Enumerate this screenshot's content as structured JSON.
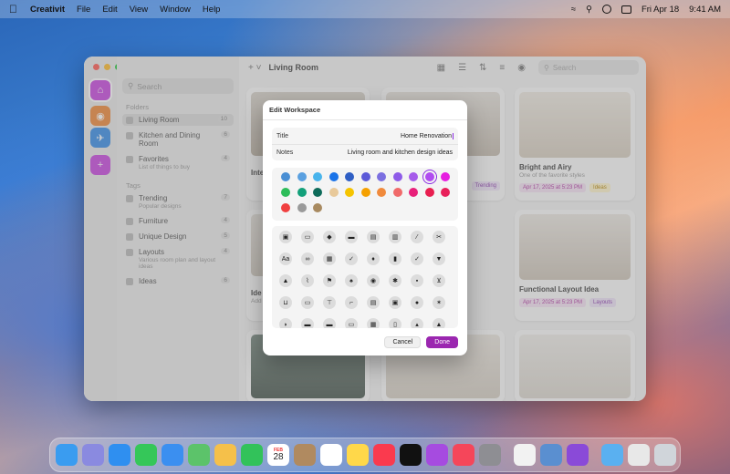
{
  "menubar": {
    "apple": "",
    "app_name": "Creativit",
    "menus": [
      "File",
      "Edit",
      "View",
      "Window",
      "Help"
    ],
    "datetime": "Fri Apr 18",
    "time": "9:41 AM"
  },
  "window": {
    "toolbar_title": "Living Room",
    "search_placeholder": "Search",
    "sidebar_search_placeholder": "Search"
  },
  "sidebar": {
    "folders_heading": "Folders",
    "folders": [
      {
        "label": "Living Room",
        "count": "10"
      },
      {
        "label": "Kitchen and Dining Room",
        "count": "6"
      },
      {
        "label": "Favorites",
        "sub": "List of things to buy",
        "count": "4"
      }
    ],
    "tags_heading": "Tags",
    "tags": [
      {
        "label": "Trending",
        "sub": "Popular designs",
        "count": "7"
      },
      {
        "label": "Furniture",
        "count": "4"
      },
      {
        "label": "Unique Design",
        "count": "5"
      },
      {
        "label": "Layouts",
        "sub": "Various room plan and layout ideas",
        "count": "4"
      },
      {
        "label": "Ideas",
        "count": "6"
      }
    ]
  },
  "cards": [
    {
      "title": "Bright and Airy",
      "sub": "One of the favorite styles",
      "date": "Apr 17, 2025 at 5:23 PM",
      "tag": "Ideas"
    },
    {
      "title": "Functional Layout Idea",
      "date": "Apr 17, 2025 at 5:23 PM",
      "tag": "Layouts"
    },
    {
      "partial_title": "Inte"
    },
    {
      "partial_title": "Ide",
      "partial_sub": "Add"
    },
    {
      "tag": "Trending"
    }
  ],
  "dialog": {
    "title": "Edit Workspace",
    "fields": [
      {
        "label": "Title",
        "value": "Home Renovation"
      },
      {
        "label": "Notes",
        "value": "Living room and kitchen design ideas"
      }
    ],
    "cancel": "Cancel",
    "done": "Done",
    "accent": "#9b27b0",
    "colors": [
      "#4a8fd4",
      "#5aa0e0",
      "#48b4ec",
      "#1a73e8",
      "#2f5fc4",
      "#5c5ad8",
      "#7b6fe0",
      "#8e5be8",
      "#a65cea",
      "#b04cf0",
      "#e61fe0",
      "#2ebd5a",
      "#13a07a",
      "#0e6b5a",
      "#e8c99a",
      "#f5c400",
      "#f5a000",
      "#f08a3c",
      "#f06a6a",
      "#e8207a",
      "#e81f50",
      "#e8205a",
      "#f04040",
      "#9a9a9a",
      "#a88a60"
    ],
    "selected_color_index": 9,
    "icons": [
      "briefcase-icon",
      "folder-icon",
      "tag-icon",
      "tray-icon",
      "archive-icon",
      "trash-icon",
      "wand-icon",
      "scissors-icon",
      "text-icon",
      "link-icon",
      "grid-icon",
      "checkmark-icon",
      "bell-icon",
      "book-icon",
      "checkmark-seal-icon",
      "bookmark-icon",
      "graduation-icon",
      "paperclip-icon",
      "flag-icon",
      "bell-fill-icon",
      "camera-icon",
      "gear-icon",
      "bag-icon",
      "cart-icon",
      "basket-icon",
      "creditcard-icon",
      "hammer-icon",
      "wrench-icon",
      "printer-icon",
      "case-icon",
      "lightbulb-icon",
      "party-icon",
      "lamp-icon",
      "bed-icon",
      "sofa-icon",
      "desk-icon",
      "radio-icon",
      "phone-icon",
      "cake-icon",
      "tent-icon"
    ],
    "text_icon_label": "Aa"
  },
  "dock": {
    "apps": [
      "finder",
      "launchpad",
      "safari",
      "messages",
      "mail",
      "maps",
      "photos",
      "facetime",
      "calendar",
      "contacts",
      "reminders",
      "notes",
      "music",
      "tv",
      "podcasts",
      "news",
      "settings",
      "textedit",
      "preview",
      "creativit",
      "folder",
      "documents",
      "trash"
    ],
    "calendar_month": "FEB",
    "calendar_day": "28"
  }
}
